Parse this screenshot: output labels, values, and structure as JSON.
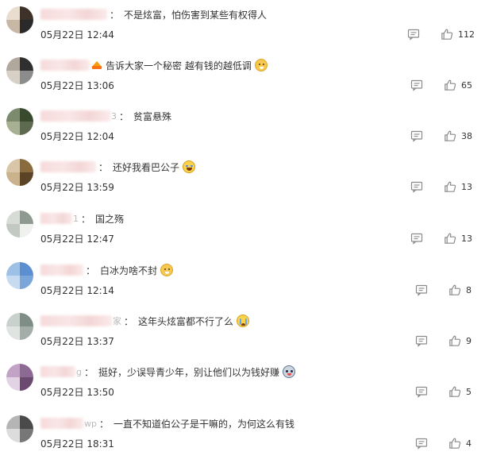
{
  "colors": {
    "text": "#333333",
    "icon": "#8a8a8a"
  },
  "comments": [
    {
      "avatar": [
        "#e9ddd0",
        "#3d3229",
        "#c7b8a6",
        "#2a2a2a"
      ],
      "nick": "",
      "nick_suffix": "",
      "text": "不是炫富，怕伤害到某些有权得人",
      "emoji": "",
      "time": "05月22日 12:44",
      "likes": "112"
    },
    {
      "avatar": [
        "#b0a89c",
        "#2f2f2f",
        "#d6d0c7",
        "#8c8c8c"
      ],
      "nick": "",
      "nick_suffix": "",
      "crown_icon": "crown-icon",
      "text": "告诉大家一个秘密 越有钱的越低调",
      "emoji": "dog-emoji",
      "time": "05月22日 13:06",
      "likes": "65"
    },
    {
      "avatar": [
        "#7c8a6e",
        "#3a4a2e",
        "#a8b094",
        "#5e6a4f"
      ],
      "nick": "",
      "nick_suffix": "3",
      "text": "贫富悬殊",
      "emoji": "",
      "time": "05月22日 12:04",
      "likes": "38"
    },
    {
      "avatar": [
        "#d9c6a8",
        "#8a6b3d",
        "#c9b28c",
        "#5b4426"
      ],
      "nick": "",
      "nick_suffix": "",
      "text": "还好我看巴公子",
      "emoji": "laugh-cry-emoji",
      "time": "05月22日 13:59",
      "likes": "13"
    },
    {
      "avatar": [
        "#d8dcd6",
        "#8e9990",
        "#c2c9c3",
        "#eef1ee"
      ],
      "nick": "",
      "nick_suffix": "1",
      "text": "国之殇",
      "emoji": "",
      "time": "05月22日 12:47",
      "likes": "13"
    },
    {
      "avatar": [
        "#9cc0e6",
        "#5b8fcf",
        "#c6daf0",
        "#7aa6d9"
      ],
      "nick": "",
      "nick_suffix": "",
      "text": "白冰为啥不封",
      "emoji": "dog-emoji",
      "time": "05月22日 12:14",
      "likes": "8"
    },
    {
      "avatar": [
        "#c9d1cc",
        "#7e8d86",
        "#e0e4e1",
        "#a3aea8"
      ],
      "nick": "",
      "nick_suffix": "家",
      "text": "这年头炫富都不行了么",
      "emoji": "crying-emoji",
      "time": "05月22日 13:37",
      "likes": "9"
    },
    {
      "avatar": [
        "#c2a3c6",
        "#8d6a93",
        "#e2d2e4",
        "#6b4a70"
      ],
      "nick": "",
      "nick_suffix": "g",
      "text": "挺好，少误导青少年，别让他们以为钱好赚",
      "emoji": "husky-emoji",
      "time": "05月22日 13:50",
      "likes": "5"
    },
    {
      "avatar": [
        "#b5b5b5",
        "#4a4a4a",
        "#dcdcdc",
        "#777777"
      ],
      "nick": "",
      "nick_suffix": "wp",
      "text": "一直不知道伯公子是干嘛的，为何这么有钱",
      "emoji": "",
      "time": "05月22日 18:31",
      "likes": "4"
    }
  ]
}
